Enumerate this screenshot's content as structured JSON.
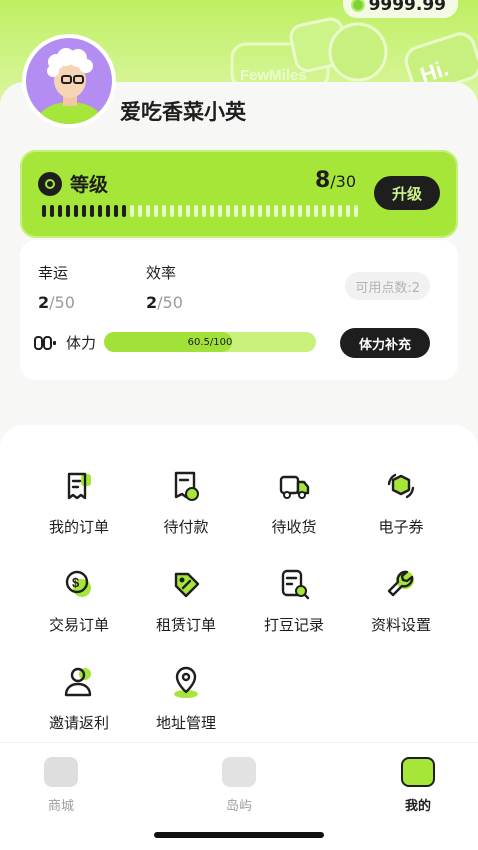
{
  "header": {
    "coins": "9999.99",
    "bg_text_1": "FewMiles",
    "bg_text_2": "Hi."
  },
  "profile": {
    "username": "爱吃香菜小英"
  },
  "level": {
    "label": "等级",
    "current": "8",
    "max": "/30",
    "upgrade_label": "升级",
    "progress_fraction": 0.27
  },
  "stats": {
    "luck": {
      "label": "幸运",
      "value": "2",
      "max": "/50"
    },
    "efficiency": {
      "label": "效率",
      "value": "2",
      "max": "/50"
    },
    "points_available": "可用点数:2",
    "stamina": {
      "label": "体力",
      "text": "60.5/100",
      "fraction": 0.605,
      "button_label": "体力补充"
    }
  },
  "menu": [
    {
      "label": "我的订单",
      "icon": "order-receipt-icon"
    },
    {
      "label": "待付款",
      "icon": "pending-payment-icon"
    },
    {
      "label": "待收货",
      "icon": "delivery-truck-icon"
    },
    {
      "label": "电子券",
      "icon": "e-coupon-icon"
    },
    {
      "label": "交易订单",
      "icon": "trade-coin-icon"
    },
    {
      "label": "租赁订单",
      "icon": "rental-tag-icon"
    },
    {
      "label": "打豆记录",
      "icon": "record-search-icon"
    },
    {
      "label": "资料设置",
      "icon": "wrench-settings-icon"
    },
    {
      "label": "邀请返利",
      "icon": "invite-user-icon"
    },
    {
      "label": "地址管理",
      "icon": "location-pin-icon"
    }
  ],
  "tabs": [
    {
      "label": "商城",
      "icon": "shop-icon",
      "active": false
    },
    {
      "label": "岛屿",
      "icon": "gamepad-icon",
      "active": false
    },
    {
      "label": "我的",
      "icon": "profile-icon",
      "active": true
    }
  ],
  "colors": {
    "accent": "#a6e639",
    "dark": "#1e1e1e"
  }
}
